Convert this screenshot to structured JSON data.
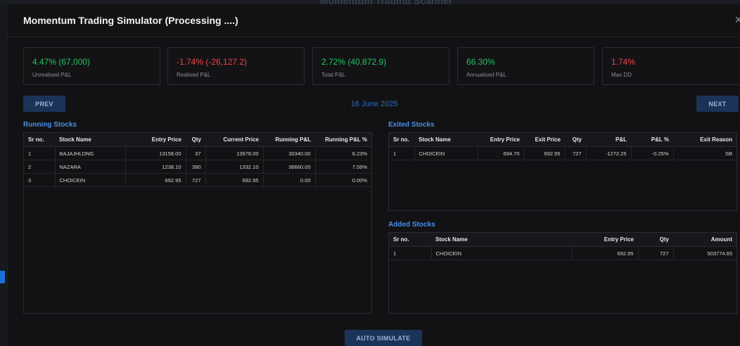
{
  "modal": {
    "title": "Momentum Trading Simulator (Processing ....)",
    "close_glyph": "×",
    "backdrop_title": "Momentum Trading Scanner"
  },
  "stats": [
    {
      "value": "4.47% (67,000)",
      "label": "Unrealised P&L",
      "tone": "pos"
    },
    {
      "value": "-1.74% (-26,127.2)",
      "label": "Realised P&L",
      "tone": "neg"
    },
    {
      "value": "2.72% (40,872.9)",
      "label": "Total P&L",
      "tone": "pos"
    },
    {
      "value": "66.30%",
      "label": "Annualised P&L",
      "tone": "pos"
    },
    {
      "value": "1.74%",
      "label": "Max DD",
      "tone": "neg"
    }
  ],
  "nav": {
    "prev_label": "PREV",
    "next_label": "NEXT",
    "date": "16 June 2025"
  },
  "running": {
    "title": "Running Stocks",
    "headers": [
      "Sr no.",
      "Stock Name",
      "Entry Price",
      "Qty",
      "Current Price",
      "Running P&L",
      "Running P&L %"
    ],
    "rows": [
      [
        "1",
        "BAJAJHLDNG",
        "13158.00",
        "37",
        "13978.00",
        "30340.00",
        "6.23%"
      ],
      [
        "2",
        "NAZARA",
        "1238.10",
        "390",
        "1332.10",
        "36660.00",
        "7.59%"
      ],
      [
        "3",
        "CHOICEIN",
        "692.95",
        "727",
        "692.95",
        "0.00",
        "0.00%"
      ]
    ]
  },
  "exited": {
    "title": "Exited Stocks",
    "headers": [
      "Sr no.",
      "Stock Name",
      "Entry Price",
      "Exit Price",
      "Qty",
      "P&L",
      "P&L %",
      "Exit Reason"
    ],
    "rows": [
      [
        "1",
        "CHOICEIN",
        "694.70",
        "692.95",
        "727",
        "-1272.25",
        "-0.25%",
        "SB"
      ]
    ]
  },
  "added": {
    "title": "Added Stocks",
    "headers": [
      "Sr no.",
      "Stock Name",
      "Entry Price",
      "Qty",
      "Amount"
    ],
    "rows": [
      [
        "1",
        "CHOICEIN",
        "692.95",
        "727",
        "503774.65"
      ]
    ]
  },
  "footer": {
    "auto_simulate_label": "AUTO SIMULATE"
  },
  "colors": {
    "positive": "#22c55e",
    "negative": "#ef4444",
    "accent": "#4a8ee8",
    "button": "#1b3358"
  }
}
